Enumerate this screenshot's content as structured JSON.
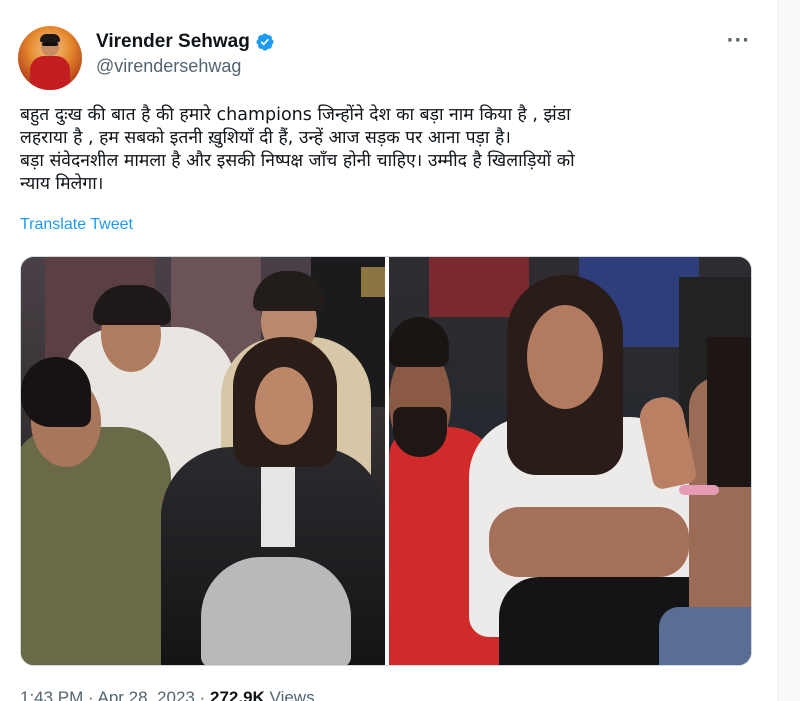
{
  "author": {
    "display_name": "Virender Sehwag",
    "handle": "@virendersehwag",
    "verified_icon": "verified-badge-icon",
    "verified_color": "#1d9bf0"
  },
  "menu": {
    "more_label": "···"
  },
  "tweet": {
    "lines": [
      "बहुत दुःख की बात है की हमारे champions जिन्होंने देश का बड़ा नाम किया है , झंडा",
      "लहराया है , हम सबको इतनी ख़ुशियाँ दी हैं, उन्हें आज सड़क पर आना पड़ा है।",
      "बड़ा संवेदनशील मामला है और इसकी निष्पक्ष जाँच होनी चाहिए। उम्मीद है खिलाड़ियों को",
      "न्याय मिलेगा।"
    ],
    "translate_label": "Translate Tweet"
  },
  "media": {
    "photos": [
      "left-photo",
      "right-photo"
    ]
  },
  "meta": {
    "time": "1:43 PM",
    "date": "Apr 28, 2023",
    "views_count": "272.9K",
    "views_label": "Views"
  },
  "colors": {
    "link": "#1d9bf0",
    "secondary_text": "#536471",
    "primary_text": "#0f1419"
  }
}
